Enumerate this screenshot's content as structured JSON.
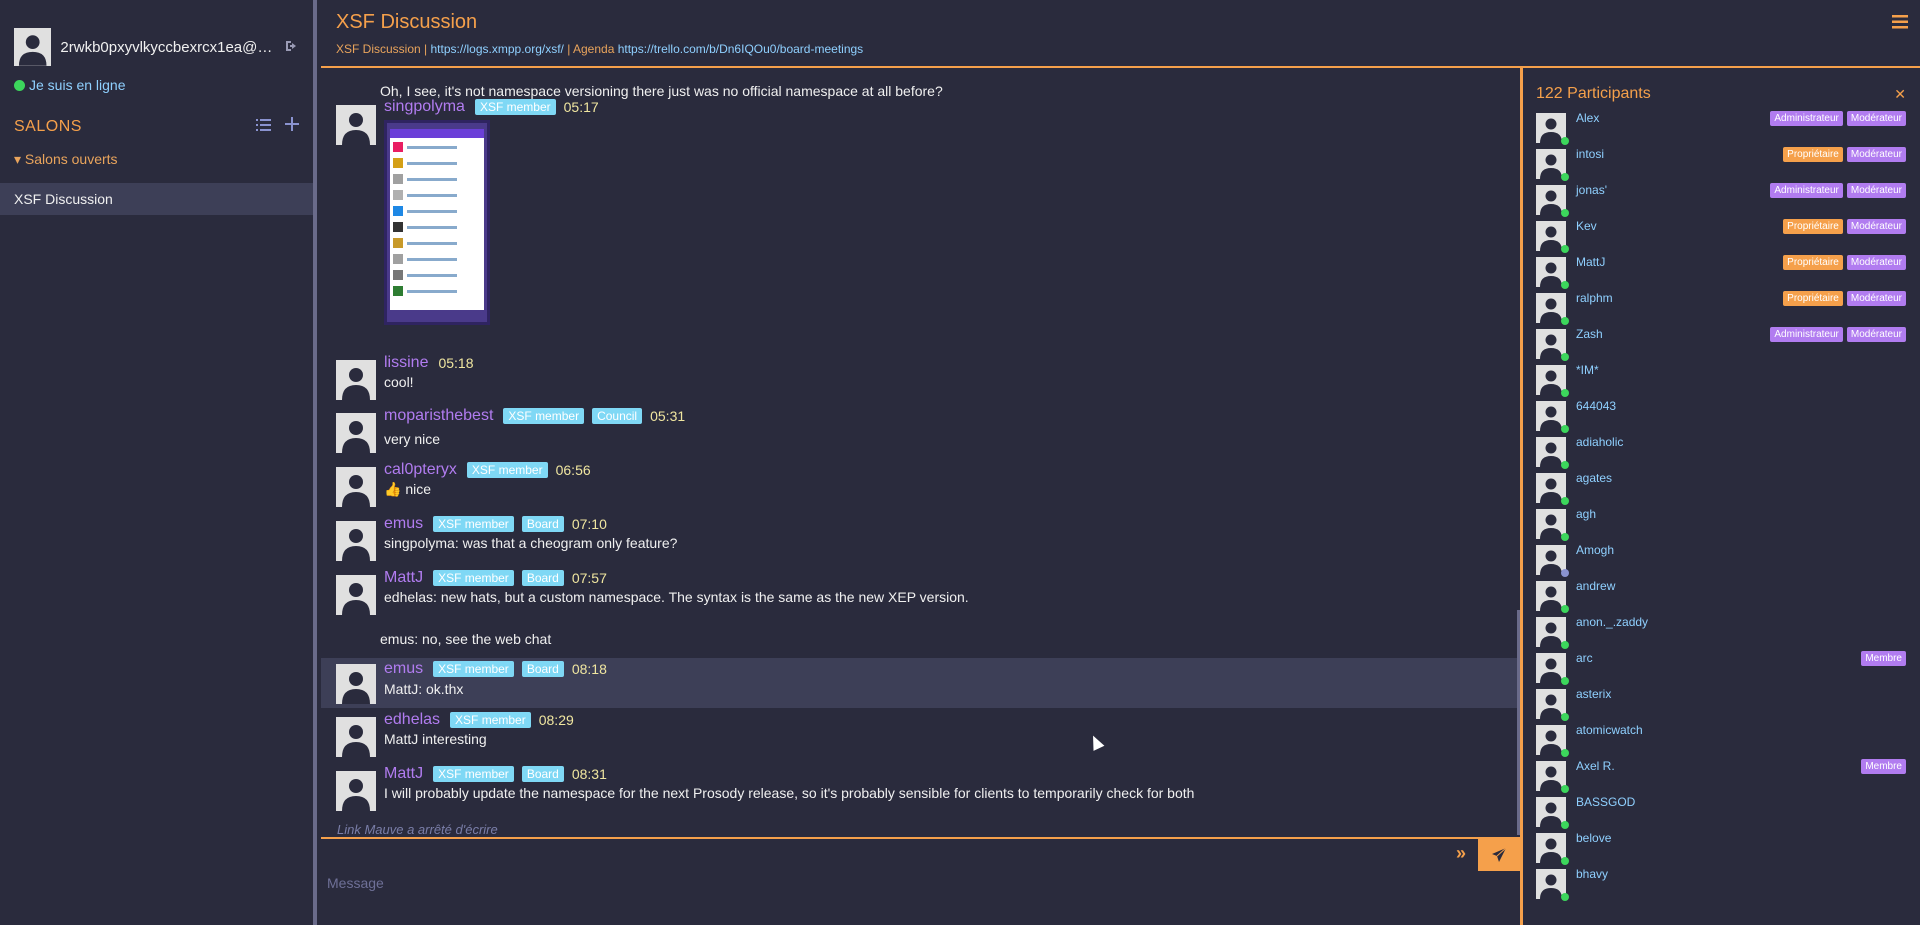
{
  "profile": {
    "name": "2rwkb0pxyvlkyccbexrcx1ea@an...",
    "status": "Je suis en ligne"
  },
  "sidebar": {
    "salons_title": "SALONS",
    "open_rooms": "Salons ouverts",
    "rooms": [
      "XSF Discussion"
    ]
  },
  "header": {
    "title": "XSF Discussion",
    "sub_prefix": "XSF Discussion | ",
    "logs_url": "https://logs.xmpp.org/xsf/",
    "agenda_prefix": " | Agenda ",
    "agenda_url": "https://trello.com/b/Dn6IQOu0/board-meetings"
  },
  "messages": {
    "m0": {
      "text": "Oh, I see, it's not namespace versioning there just was no official namespace at all before?"
    },
    "m1": {
      "nick": "singpolyma",
      "badges": [
        "XSF member"
      ],
      "time": "05:17"
    },
    "m2": {
      "nick": "lissine",
      "time": "05:18",
      "text": "cool!"
    },
    "m3": {
      "nick": "moparisthebest",
      "badges": [
        "XSF member",
        "Council"
      ],
      "time": "05:31",
      "text": "very nice"
    },
    "m4": {
      "nick": "cal0pteryx",
      "badges": [
        "XSF member"
      ],
      "time": "06:56",
      "text": "👍 nice"
    },
    "m5": {
      "nick": "emus",
      "badges": [
        "XSF member",
        "Board"
      ],
      "time": "07:10",
      "text": "singpolyma: was that a cheogram only feature?"
    },
    "m6": {
      "nick": "MattJ",
      "badges": [
        "XSF member",
        "Board"
      ],
      "time": "07:57",
      "text": "edhelas: new hats, but a custom namespace. The syntax is the same as the new XEP version."
    },
    "m6b": {
      "text": "emus: no, see the web chat"
    },
    "m7": {
      "nick": "emus",
      "badges": [
        "XSF member",
        "Board"
      ],
      "time": "08:18",
      "text": "MattJ: ok.thx"
    },
    "m8": {
      "nick": "edhelas",
      "badges": [
        "XSF member"
      ],
      "time": "08:29",
      "text": "MattJ interesting"
    },
    "m9": {
      "nick": "MattJ",
      "badges": [
        "XSF member",
        "Board"
      ],
      "time": "08:31",
      "text": "I will probably update the namespace for the next Prosody release, so it's probably sensible for clients to temporarily check for both"
    }
  },
  "typing": "Link Mauve a arrêté d'écrire",
  "composer": {
    "placeholder": "Message"
  },
  "participants": {
    "title": "122 Participants",
    "list": [
      {
        "name": "Alex",
        "roles": [
          "Administrateur",
          "Modérateur"
        ]
      },
      {
        "name": "intosi",
        "roles": [
          "Propriétaire",
          "Modérateur"
        ]
      },
      {
        "name": "jonas'",
        "roles": [
          "Administrateur",
          "Modérateur"
        ]
      },
      {
        "name": "Kev",
        "roles": [
          "Propriétaire",
          "Modérateur"
        ]
      },
      {
        "name": "MattJ",
        "roles": [
          "Propriétaire",
          "Modérateur"
        ]
      },
      {
        "name": "ralphm",
        "roles": [
          "Propriétaire",
          "Modérateur"
        ]
      },
      {
        "name": "Zash",
        "roles": [
          "Administrateur",
          "Modérateur"
        ]
      },
      {
        "name": "*IM*",
        "roles": []
      },
      {
        "name": "644043",
        "roles": []
      },
      {
        "name": "adiaholic",
        "roles": []
      },
      {
        "name": "agates",
        "roles": []
      },
      {
        "name": "agh",
        "roles": []
      },
      {
        "name": "Amogh",
        "roles": []
      },
      {
        "name": "andrew",
        "roles": []
      },
      {
        "name": "anon._.zaddy",
        "roles": []
      },
      {
        "name": "arc",
        "roles": [
          "Membre"
        ]
      },
      {
        "name": "asterix",
        "roles": []
      },
      {
        "name": "atomicwatch",
        "roles": []
      },
      {
        "name": "Axel R.",
        "roles": [
          "Membre"
        ]
      },
      {
        "name": "BASSGOD",
        "roles": []
      },
      {
        "name": "belove",
        "roles": []
      },
      {
        "name": "bhavy",
        "roles": []
      }
    ]
  }
}
